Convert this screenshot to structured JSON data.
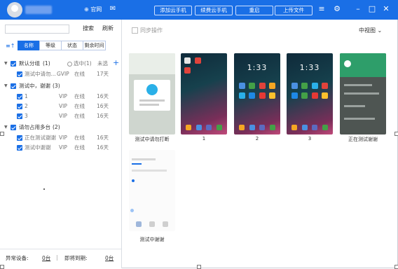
{
  "titlebar": {
    "website_label": "官网",
    "buttons": [
      "添加云手机",
      "续费云手机",
      "重启",
      "上传文件"
    ]
  },
  "left": {
    "search_label": "搜索",
    "refresh_label": "刷新",
    "tabs": [
      "名称",
      "等级",
      "状态",
      "剩余时间"
    ],
    "groups": [
      {
        "name": "默认分组",
        "count": "(1)",
        "selected_label": "选中(1)",
        "unexpired_label": "未选",
        "devices": [
          {
            "name": "测试中请勿...",
            "level": "GVIP",
            "status": "在线",
            "remaining": "17天"
          }
        ]
      },
      {
        "name": "测试中，谢谢",
        "count": "(3)",
        "devices": [
          {
            "name": "1",
            "level": "VIP",
            "status": "在线",
            "remaining": "16天"
          },
          {
            "name": "2",
            "level": "VIP",
            "status": "在线",
            "remaining": "16天"
          },
          {
            "name": "3",
            "level": "VIP",
            "status": "在线",
            "remaining": "16天"
          }
        ]
      },
      {
        "name": "请勿占用多台",
        "count": "(2)",
        "devices": [
          {
            "name": "正在测试谢谢",
            "level": "VIP",
            "status": "在线",
            "remaining": "16天"
          },
          {
            "name": "测试中谢谢",
            "level": "VIP",
            "status": "在线",
            "remaining": "16天"
          }
        ]
      }
    ],
    "footer": {
      "abnormal_label": "异常设备:",
      "abnormal_count": "0台",
      "expiring_label": "即将到期:",
      "expiring_count": "0台"
    }
  },
  "right": {
    "sync_label": "同步操作",
    "view_mode": "中视图",
    "phones": [
      {
        "caption": "测试中请勿打断"
      },
      {
        "caption": "1"
      },
      {
        "caption": "2",
        "clock": "1:33"
      },
      {
        "caption": "3",
        "clock": "1:33"
      },
      {
        "caption": "正在测试谢谢"
      },
      {
        "caption": "测试中谢谢"
      }
    ]
  },
  "colors": {
    "accent": "#1a6fe6",
    "title_bar": "#1a6fe6"
  }
}
